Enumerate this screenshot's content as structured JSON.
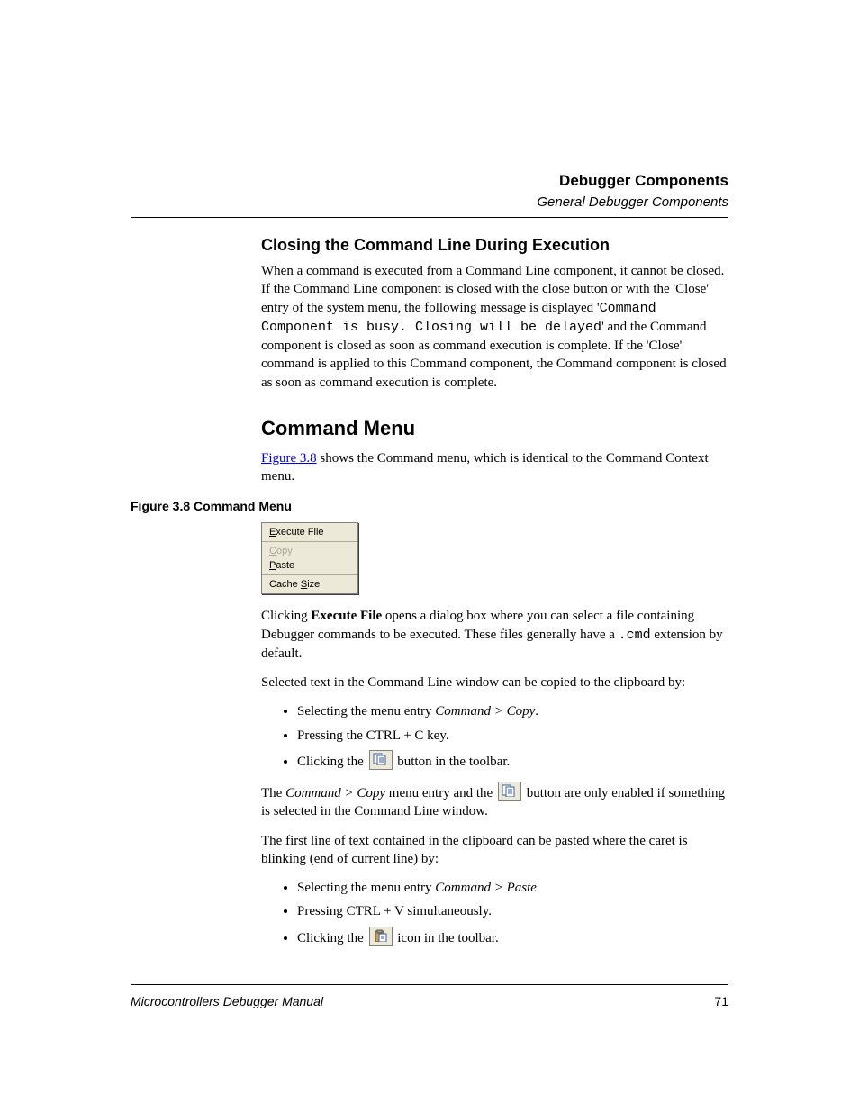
{
  "header": {
    "title": "Debugger Components",
    "subtitle": "General Debugger Components"
  },
  "section1": {
    "heading": "Closing the Command Line During Execution",
    "p1_a": "When a command is executed from a Command Line component, it cannot be closed. If the Command Line component is closed with the close button or with the 'Close' entry of the system menu, the following message is displayed '",
    "p1_code": "Command Component is busy. Closing will be delayed",
    "p1_b": "' and the Command component is closed as soon as command execution is complete. If the 'Close' command is applied to this Command component, the Command component is closed as soon as command execution is complete."
  },
  "section2": {
    "heading": "Command Menu",
    "intro_link": "Figure 3.8",
    "intro_rest": " shows the Command menu, which is identical to the Command Context menu.",
    "fig_caption": "Figure 3.8  Command Menu",
    "menu": {
      "execute": "Execute File",
      "copy": "Copy",
      "paste": "Paste",
      "cache": "Cache Size"
    },
    "p2_a": "Clicking ",
    "p2_bold": "Execute File",
    "p2_b": " opens a dialog box where you can select a file containing Debugger commands to be executed. These files generally have a ",
    "p2_code": ".cmd",
    "p2_c": " extension by default.",
    "p3": "Selected text in the Command Line window can be copied to the clipboard by:",
    "copy_list": {
      "i1_a": "Selecting the menu entry ",
      "i1_i": "Command > Copy",
      "i1_b": ".",
      "i2": "Pressing the CTRL + C key.",
      "i3_a": "Clicking the ",
      "i3_b": " button in the toolbar."
    },
    "p4_a": "The ",
    "p4_i": "Command > Copy",
    "p4_b": " menu entry and the ",
    "p4_c": " button are only enabled if something is selected in the Command Line window.",
    "p5": "The first line of text contained in the clipboard can be pasted where the caret is blinking (end of current line) by:",
    "paste_list": {
      "i1_a": "Selecting the menu entry ",
      "i1_i": "Command > Paste",
      "i2": "Pressing CTRL + V simultaneously.",
      "i3_a": "Clicking the ",
      "i3_b": " icon in the toolbar."
    }
  },
  "footer": {
    "manual": "Microcontrollers Debugger Manual",
    "page": "71"
  }
}
